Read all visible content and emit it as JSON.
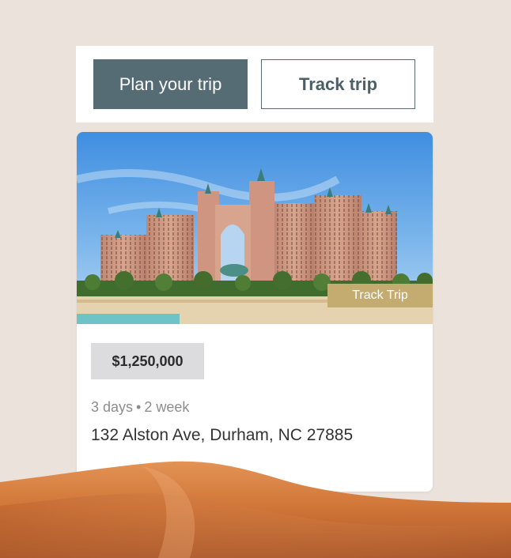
{
  "tabs": {
    "plan_label": "Plan your trip",
    "track_label": "Track trip"
  },
  "listing": {
    "badge_label": "Track Trip",
    "price": "$1,250,000",
    "duration_days": "3 days",
    "separator": "•",
    "duration_weeks": "2 week",
    "address": "132 Alston Ave, Durham, NC 27885"
  },
  "colors": {
    "primary": "#566c75",
    "badge": "#c4ab70",
    "background": "#ebe2dc",
    "sand": "#d97f44"
  }
}
